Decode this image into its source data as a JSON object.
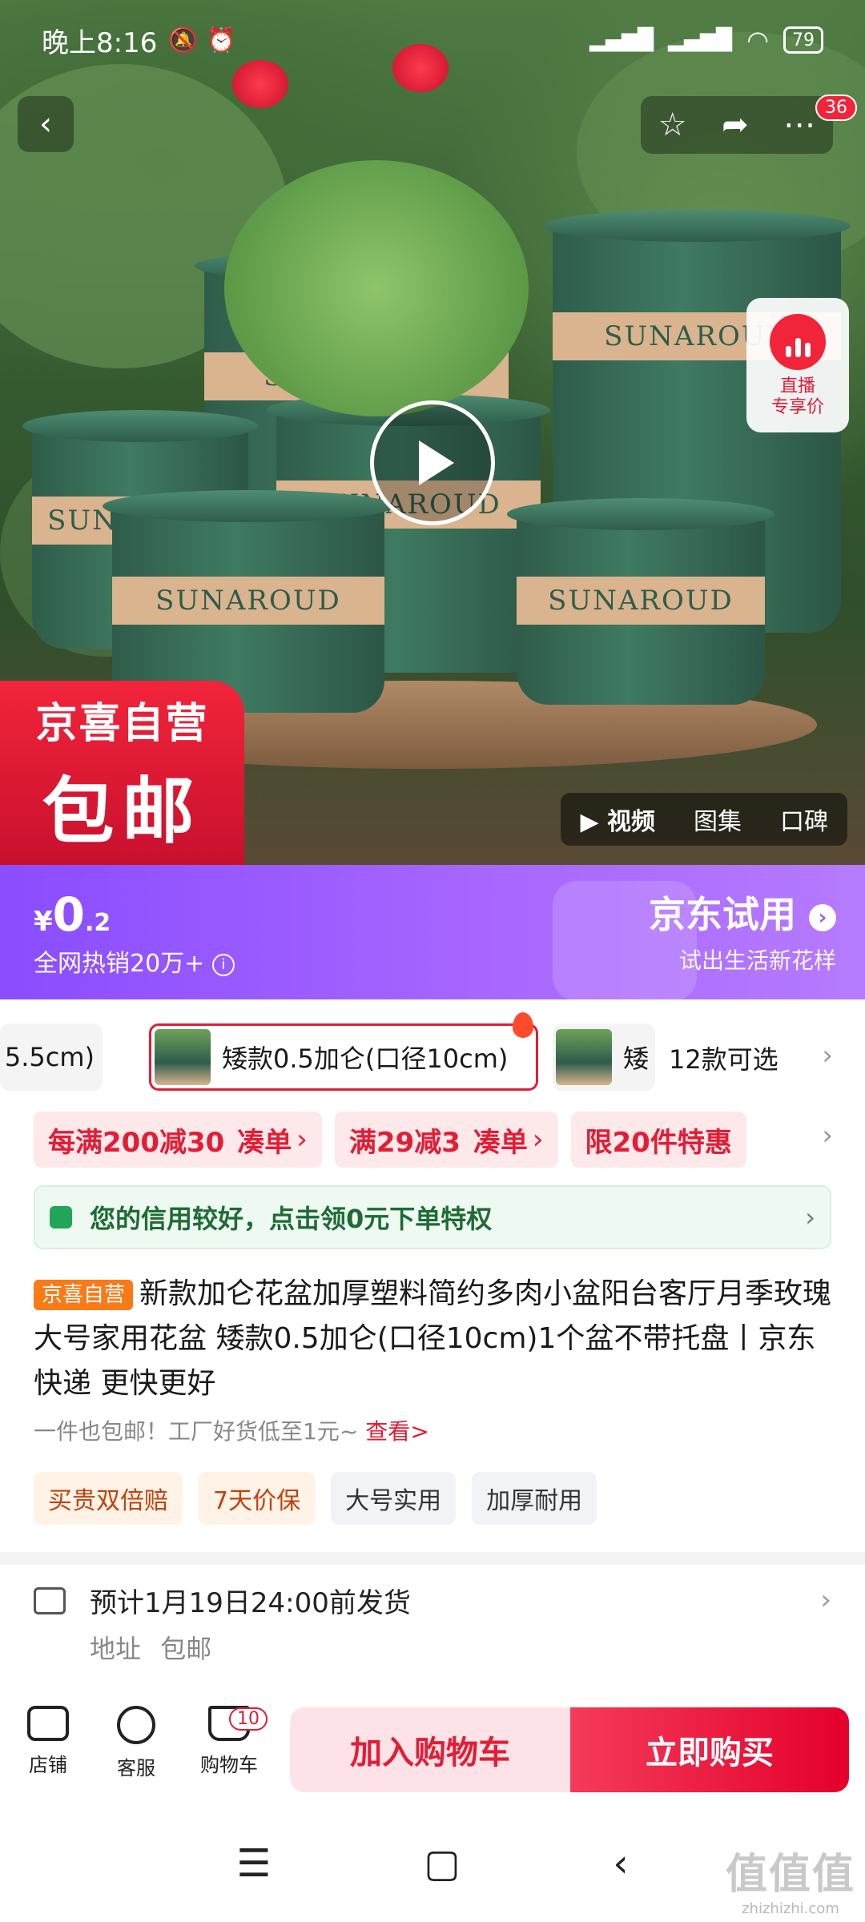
{
  "status_bar": {
    "time": "晚上8:16",
    "battery": "79"
  },
  "header": {
    "cart_badge_count": "36"
  },
  "hero": {
    "pot_brand": "SUNAROUD",
    "live_label": "直播\n专享价",
    "badge_line1": "京喜自营",
    "badge_line2": "包邮",
    "media_tabs": [
      "▶ 视频",
      "图集",
      "口碑"
    ]
  },
  "promo": {
    "currency": "¥",
    "price_int": "0",
    "price_dec": ".2",
    "hot_sales": "全网热销20万+",
    "info_icon": "i",
    "trial_title": "京东试用",
    "trial_sub": "试出生活新花样"
  },
  "variants": {
    "prev_partial": "5.5cm)",
    "selected": "矮款0.5加仑(口径10cm)",
    "next_partial": "矮",
    "count_label": "12款可选"
  },
  "coupons": [
    {
      "label": "每满200减30",
      "action": "凑单"
    },
    {
      "label": "满29减3",
      "action": "凑单"
    },
    {
      "label": "限20件特惠",
      "action": ""
    }
  ],
  "credit": {
    "text": "您的信用较好，点击领0元下单特权"
  },
  "product": {
    "shop_tag": "京喜自营",
    "title": "新款加仑花盆加厚塑料简约多肉小盆阳台客厅月季玫瑰大号家用花盆 矮款0.5加仑(口径10cm)1个盆不带托盘丨京东快递 更快更好",
    "subtitle": "一件也包邮！工厂好货低至1元~ ",
    "subtitle_link": "查看>",
    "tags": [
      "买贵双倍赔",
      "7天价保",
      "大号实用",
      "加厚耐用"
    ]
  },
  "shipping": {
    "estimate": "预计1月19日24:00前发货",
    "address_label": "地址",
    "address_value": "包邮"
  },
  "actions": {
    "shop": "店铺",
    "service": "客服",
    "cart": "购物车",
    "cart_count": "10",
    "add_to_cart": "加入购物车",
    "buy_now": "立即购买"
  },
  "watermark": {
    "big": "值值值",
    "small": "zhizhizhi.com"
  },
  "colors": {
    "accent_red": "#e21d36",
    "promo_purple": "#9b5cff",
    "credit_green": "#21a558"
  }
}
